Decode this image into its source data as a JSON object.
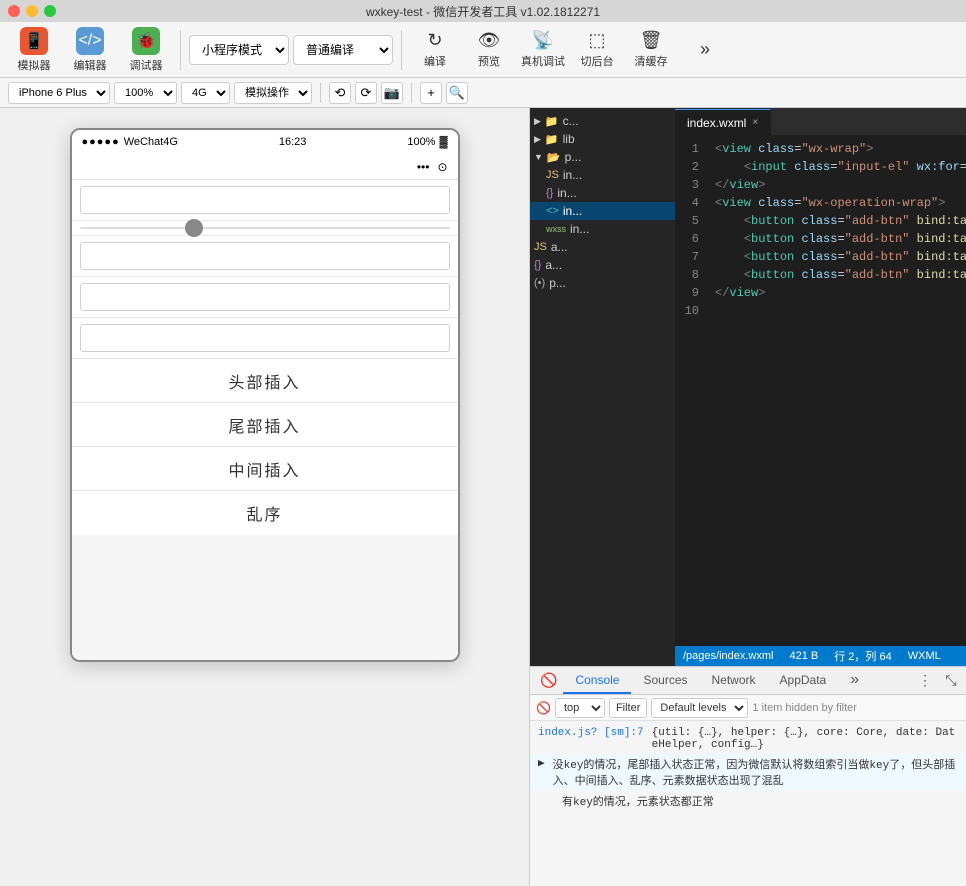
{
  "titlebar": {
    "title": "wxkey-test - 微信开发者工具 v1.02.1812271"
  },
  "toolbar": {
    "simulator_label": "模拟器",
    "editor_label": "编辑器",
    "debugger_label": "调试器",
    "mode_label": "小程序模式",
    "compile_label": "普通编译",
    "compile_icon": "↻",
    "preview_label": "预览",
    "device_label": "真机调试",
    "cutback_label": "切后台",
    "clear_label": "清缓存",
    "more_icon": "»"
  },
  "subtoolbar": {
    "device": "iPhone 6 Plus",
    "zoom": "100%",
    "network": "4G",
    "operation": "模拟操作",
    "add_icon": "+",
    "search_icon": "⌕"
  },
  "phone": {
    "status_left": "●●●●● WeChat4G",
    "time": "16:23",
    "battery": "100%",
    "battery_icon": "🔋",
    "dots": "•••",
    "inputs": [
      "",
      "",
      "",
      ""
    ],
    "buttons": [
      "头部插入",
      "尾部插入",
      "中间插入",
      "乱序"
    ]
  },
  "file_tree": {
    "items": [
      {
        "type": "folder",
        "label": "c...",
        "indent": 0,
        "arrow": "▶"
      },
      {
        "type": "folder",
        "label": "lib",
        "indent": 0,
        "arrow": "▶"
      },
      {
        "type": "folder",
        "label": "p...",
        "indent": 0,
        "arrow": "▼",
        "open": true
      },
      {
        "type": "js",
        "label": "in...",
        "indent": 1
      },
      {
        "type": "json",
        "label": "in...",
        "indent": 1
      },
      {
        "type": "xml",
        "label": "in...",
        "indent": 1,
        "selected": true
      },
      {
        "type": "wxss",
        "label": "in...",
        "indent": 1
      },
      {
        "type": "js",
        "label": "a...",
        "indent": 0
      },
      {
        "type": "json",
        "label": "a...",
        "indent": 0
      },
      {
        "type": "other",
        "label": "p...",
        "indent": 0
      }
    ]
  },
  "editor": {
    "tab_label": "index.wxml",
    "status_file": "/pages/index.wxml",
    "status_size": "421 B",
    "status_pos": "行 2，列 64",
    "status_lang": "WXML",
    "code_lines": [
      {
        "num": 1,
        "content": "<view class=\"wx-wrap\">"
      },
      {
        "num": 2,
        "content": "  <input class=\"input-el\" wx:for=\"{{inputList}}\" wx:key=\"sort\"/>"
      },
      {
        "num": 3,
        "content": "</view>"
      },
      {
        "num": 4,
        "content": "<view class=\"wx-operation-wrap\">"
      },
      {
        "num": 5,
        "content": "  <button class=\"add-btn\" bind:tap=\"insertHead\">头部插入</button>"
      },
      {
        "num": 6,
        "content": "  <button class=\"add-btn\" bind:tap=\"insertTail\">尾部插入</button>"
      },
      {
        "num": 7,
        "content": "  <button class=\"add-btn\" bind:tap=\"insertBetween\">中间插入</button>"
      },
      {
        "num": 8,
        "content": "  <button class=\"add-btn\" bind:tap=\"reverse\">乱序</button>"
      },
      {
        "num": 9,
        "content": "</view>"
      },
      {
        "num": 10,
        "content": ""
      }
    ]
  },
  "devtools": {
    "tabs": [
      "Console",
      "Sources",
      "Network",
      "AppData"
    ],
    "active_tab": "Console",
    "filter": {
      "block_icon": "🚫",
      "dropdown_value": "top",
      "filter_btn": "Filter",
      "level_value": "Default levels",
      "warning": "1 item hidden by filter"
    },
    "console_lines": [
      {
        "type": "source",
        "source": "index.js? [sm]:7",
        "text": "{util: {…}, helper: {…}, core: Core, date: DateHelper, config…}"
      },
      {
        "type": "info",
        "arrow": "▶",
        "text": "没key的情况，尾部插入状态正常，因为微信默认将数组索引当做key了，但头部插入、中间插入、乱序、元素数据状态出现了混乱"
      },
      {
        "type": "log",
        "text": "有key的情况，元素状态都正常"
      }
    ]
  }
}
